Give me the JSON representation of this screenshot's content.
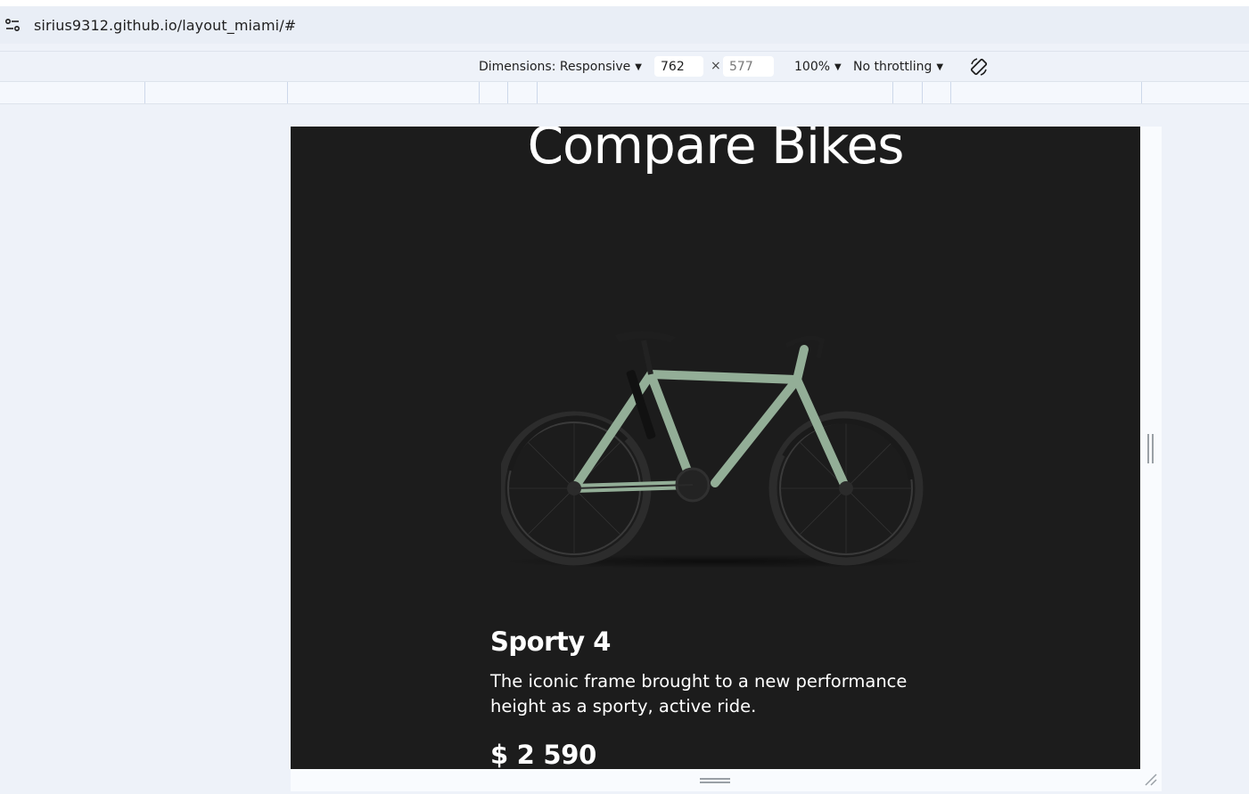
{
  "browser": {
    "url": "sirius9312.github.io/layout_miami/#",
    "site_info_icon": "tune-icon"
  },
  "device_toolbar": {
    "dimensions_label": "Dimensions: Responsive",
    "width_value": "762",
    "height_value": "577",
    "times_sign": "×",
    "zoom_label": "100%",
    "throttling_label": "No throttling",
    "rotate_icon": "rotate-device-icon"
  },
  "page": {
    "section_title": "Compare Bikes",
    "product": {
      "name": "Sporty 4",
      "description": "The iconic frame brought to a new performance height as a sporty, active ride.",
      "price": "$ 2 590",
      "frame_color": "#93ae97"
    },
    "background_color": "#1c1c1c"
  }
}
